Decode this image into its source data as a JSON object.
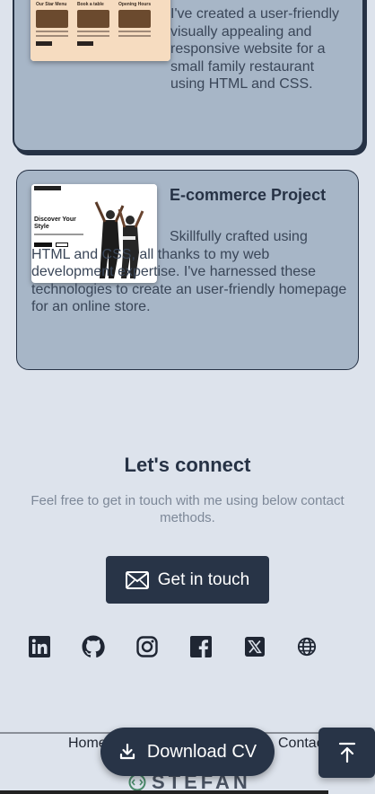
{
  "projects": [
    {
      "description": "I've created a user-friendly visually appealing and responsive website for a small family restaurant using HTML and CSS.",
      "thumb": {
        "col1": "Our Star Menu",
        "col2": "Book a table",
        "col3": "Opening Hours"
      }
    },
    {
      "title": "E-commerce Project",
      "description": "Skillfully crafted using HTML and CSS, all thanks to my web development expertise. I've harnessed these technologies to create an user-friendly homepage for an online store.",
      "thumb": {
        "headline": "Discover Your Style"
      }
    }
  ],
  "connect": {
    "title": "Let's connect",
    "description": "Feel free to get in touch with me using below contact methods.",
    "button_label": "Get in touch"
  },
  "socials": [
    {
      "icon": "linkedin-icon"
    },
    {
      "icon": "github-icon"
    },
    {
      "icon": "instagram-icon"
    },
    {
      "icon": "facebook-icon"
    },
    {
      "icon": "x-icon"
    },
    {
      "icon": "globe-icon"
    }
  ],
  "footer": {
    "home_label": "Home",
    "contact_label": "Contac",
    "download_label": "Download CV",
    "brand": "STEFAN"
  },
  "colors": {
    "background": "#dde3ec",
    "card": "#a7b6c7",
    "primary": "#283447"
  }
}
